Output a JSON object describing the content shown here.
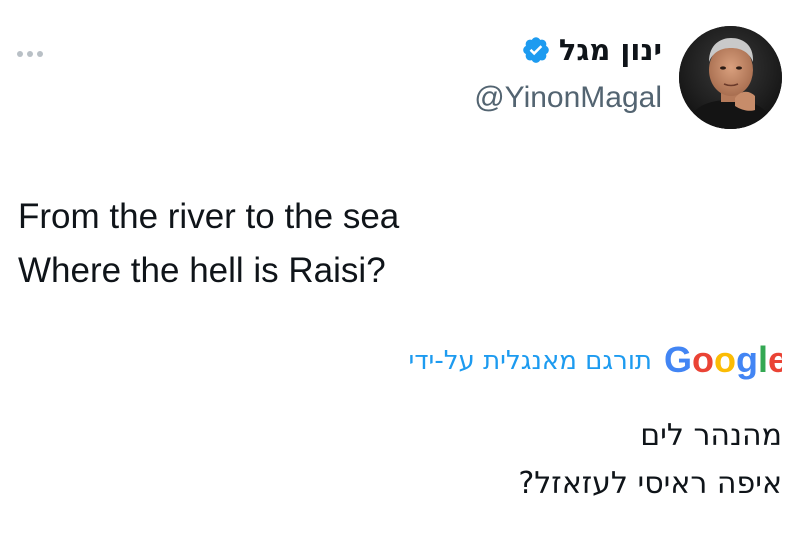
{
  "tweet": {
    "author": {
      "display_name": "ינון מגל",
      "handle": "@YinonMagal",
      "verified": true,
      "verified_icon": "verified-badge-icon",
      "avatar_icon": "avatar-photo"
    },
    "more_icon": "more-options-icon",
    "text_lines": [
      "From the river to the sea",
      "Where the hell is Raisi?"
    ],
    "translation": {
      "label": "תורגם מאנגלית על-ידי",
      "provider_logo_text": "Google",
      "lines": [
        "מהנהר לים",
        "איפה ראיסי לעזאזל?"
      ]
    }
  },
  "colors": {
    "text": "#0f1419",
    "secondary_text": "#536471",
    "accent": "#1d9bf0",
    "verified": "#1d9bf0",
    "more_dots": "#b9c0c6"
  }
}
